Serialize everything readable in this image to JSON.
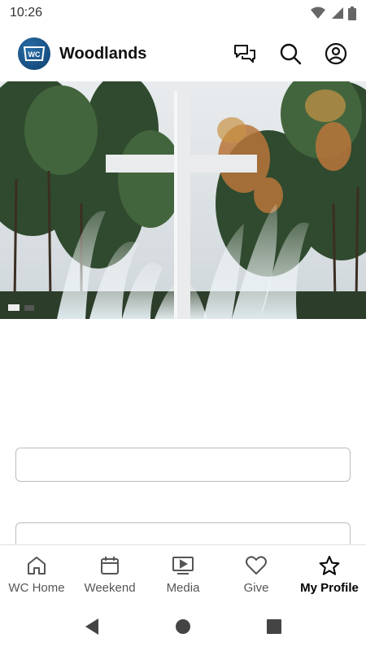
{
  "status_bar": {
    "time": "10:26",
    "icons": [
      "wifi-icon",
      "cell-signal-icon",
      "battery-icon"
    ]
  },
  "header": {
    "logo_text": "WC",
    "title": "Woodlands",
    "actions": [
      "chat-icon",
      "search-icon",
      "profile-icon"
    ],
    "brand_color": "#1a5a91"
  },
  "hero": {
    "subject": "white cross with fountains and pine trees"
  },
  "form": {
    "field_1": {
      "value": "",
      "placeholder": ""
    },
    "field_2": {
      "value": "",
      "placeholder": ""
    }
  },
  "bottom_nav": {
    "items": [
      {
        "label": "WC Home",
        "icon": "home-icon",
        "active": false
      },
      {
        "label": "Weekend",
        "icon": "calendar-icon",
        "active": false
      },
      {
        "label": "Media",
        "icon": "play-icon",
        "active": false
      },
      {
        "label": "Give",
        "icon": "heart-icon",
        "active": false
      },
      {
        "label": "My Profile",
        "icon": "star-icon",
        "active": true
      }
    ]
  },
  "system_nav": {
    "buttons": [
      "back-icon",
      "home-circle-icon",
      "recents-icon"
    ]
  }
}
